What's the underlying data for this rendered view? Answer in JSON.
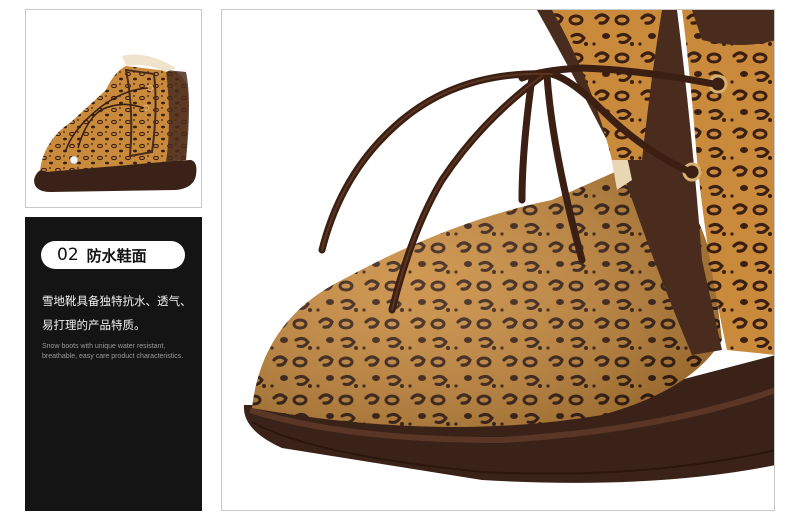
{
  "feature": {
    "number": "02",
    "title": "防水鞋面",
    "description_cn": "雪地靴具备独特抗水、透气、易打理的产品特质。",
    "description_en": "Snow boots with unique water resistant, breathable, easy care product characteristics."
  },
  "colors": {
    "panel_bg": "#141414",
    "leopard_base": "#c98a3c",
    "spot": "#3a1f12",
    "suede_brown": "#4a2c1e",
    "sole": "#3b2218"
  }
}
